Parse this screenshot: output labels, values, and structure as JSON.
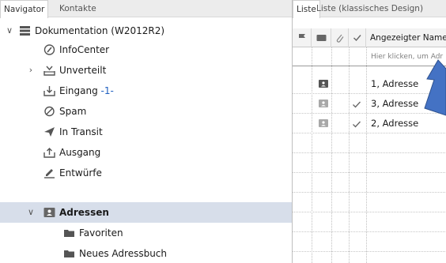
{
  "left_tabs": {
    "navigator": "Navigator",
    "kontakte": "Kontakte"
  },
  "tree": {
    "root": {
      "label": "Dokumentation (W2012R2)"
    },
    "infocenter": {
      "label": "InfoCenter"
    },
    "unverteilt": {
      "label": "Unverteilt"
    },
    "eingang": {
      "label": "Eingang",
      "count": "-1-"
    },
    "spam": {
      "label": "Spam"
    },
    "in_transit": {
      "label": "In Transit"
    },
    "ausgang": {
      "label": "Ausgang"
    },
    "entwuerfe": {
      "label": "Entwürfe"
    },
    "adressen": {
      "label": "Adressen"
    },
    "favoriten": {
      "label": "Favoriten"
    },
    "neues_adressbuch": {
      "label": "Neues Adressbuch"
    }
  },
  "right_tabs": {
    "liste": "Liste",
    "liste_klassisch": "Liste (klassisches Design)"
  },
  "grid": {
    "column_name": "Angezeigter Name",
    "filter_placeholder": "Hier klicken, um Adr",
    "rows": [
      {
        "name": "1, Adresse",
        "checked": false,
        "dimmed": false
      },
      {
        "name": "3, Adresse",
        "checked": true,
        "dimmed": true
      },
      {
        "name": "2, Adresse",
        "checked": true,
        "dimmed": true
      }
    ]
  },
  "colors": {
    "selection": "#d7deea",
    "accent_blue": "#4472c4",
    "count_blue": "#2060c0"
  }
}
